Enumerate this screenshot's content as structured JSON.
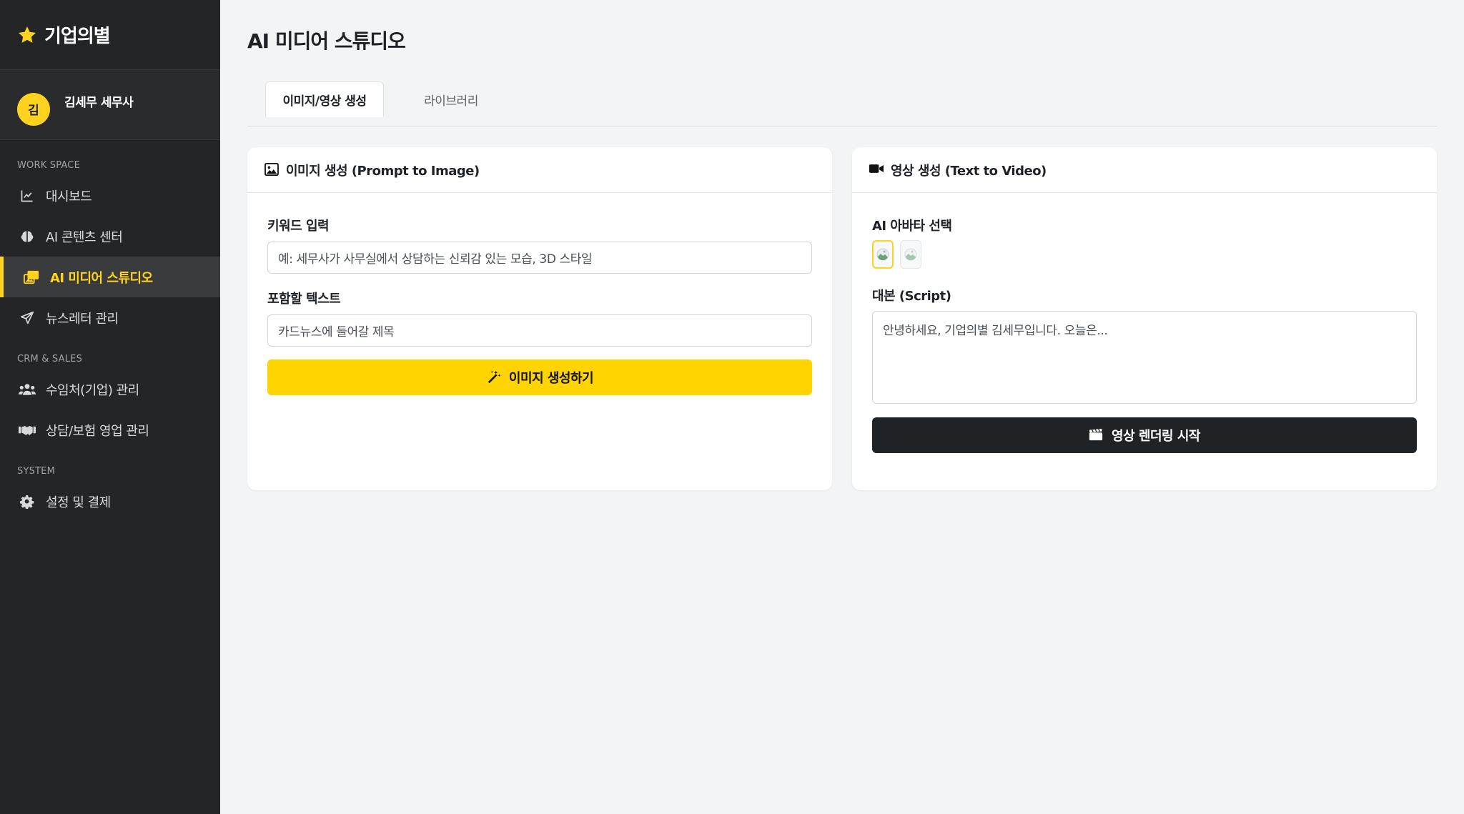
{
  "sidebar": {
    "brand": "기업의별",
    "profile": {
      "initial": "김",
      "name": "김세무 세무사"
    },
    "sections": [
      {
        "label": "WORK SPACE"
      },
      {
        "label": "CRM & SALES"
      },
      {
        "label": "SYSTEM"
      }
    ],
    "items": [
      {
        "label": "대시보드",
        "icon": "chart-line-icon"
      },
      {
        "label": "AI 콘텐츠 센터",
        "icon": "brain-icon"
      },
      {
        "label": "AI 미디어 스튜디오",
        "icon": "photo-video-icon",
        "active": true
      },
      {
        "label": "뉴스레터 관리",
        "icon": "paper-plane-icon"
      },
      {
        "label": "수임처(기업) 관리",
        "icon": "users-icon"
      },
      {
        "label": "상담/보험 영업 관리",
        "icon": "handshake-icon"
      },
      {
        "label": "설정 및 결제",
        "icon": "gear-icon"
      }
    ]
  },
  "main": {
    "title": "AI 미디어 스튜디오",
    "tabs": [
      {
        "label": "이미지/영상 생성",
        "active": true
      },
      {
        "label": "라이브러리",
        "active": false
      }
    ],
    "image_card": {
      "title": "이미지 생성 (Prompt to Image)",
      "keyword_label": "키워드 입력",
      "keyword_placeholder": "예: 세무사가 사무실에서 상담하는 신뢰감 있는 모습, 3D 스타일",
      "text_label": "포함할 텍스트",
      "text_placeholder": "카드뉴스에 들어갈 제목",
      "button": "이미지 생성하기"
    },
    "video_card": {
      "title": "영상 생성 (Text to Video)",
      "avatar_label": "AI 아바타 선택",
      "script_label": "대본 (Script)",
      "script_placeholder": "안녕하세요, 기업의별 김세무입니다. 오늘은...",
      "button": "영상 렌더링 시작"
    }
  },
  "colors": {
    "accent": "#ffd400",
    "sidebar_bg": "#242526",
    "dark_button": "#202326"
  }
}
